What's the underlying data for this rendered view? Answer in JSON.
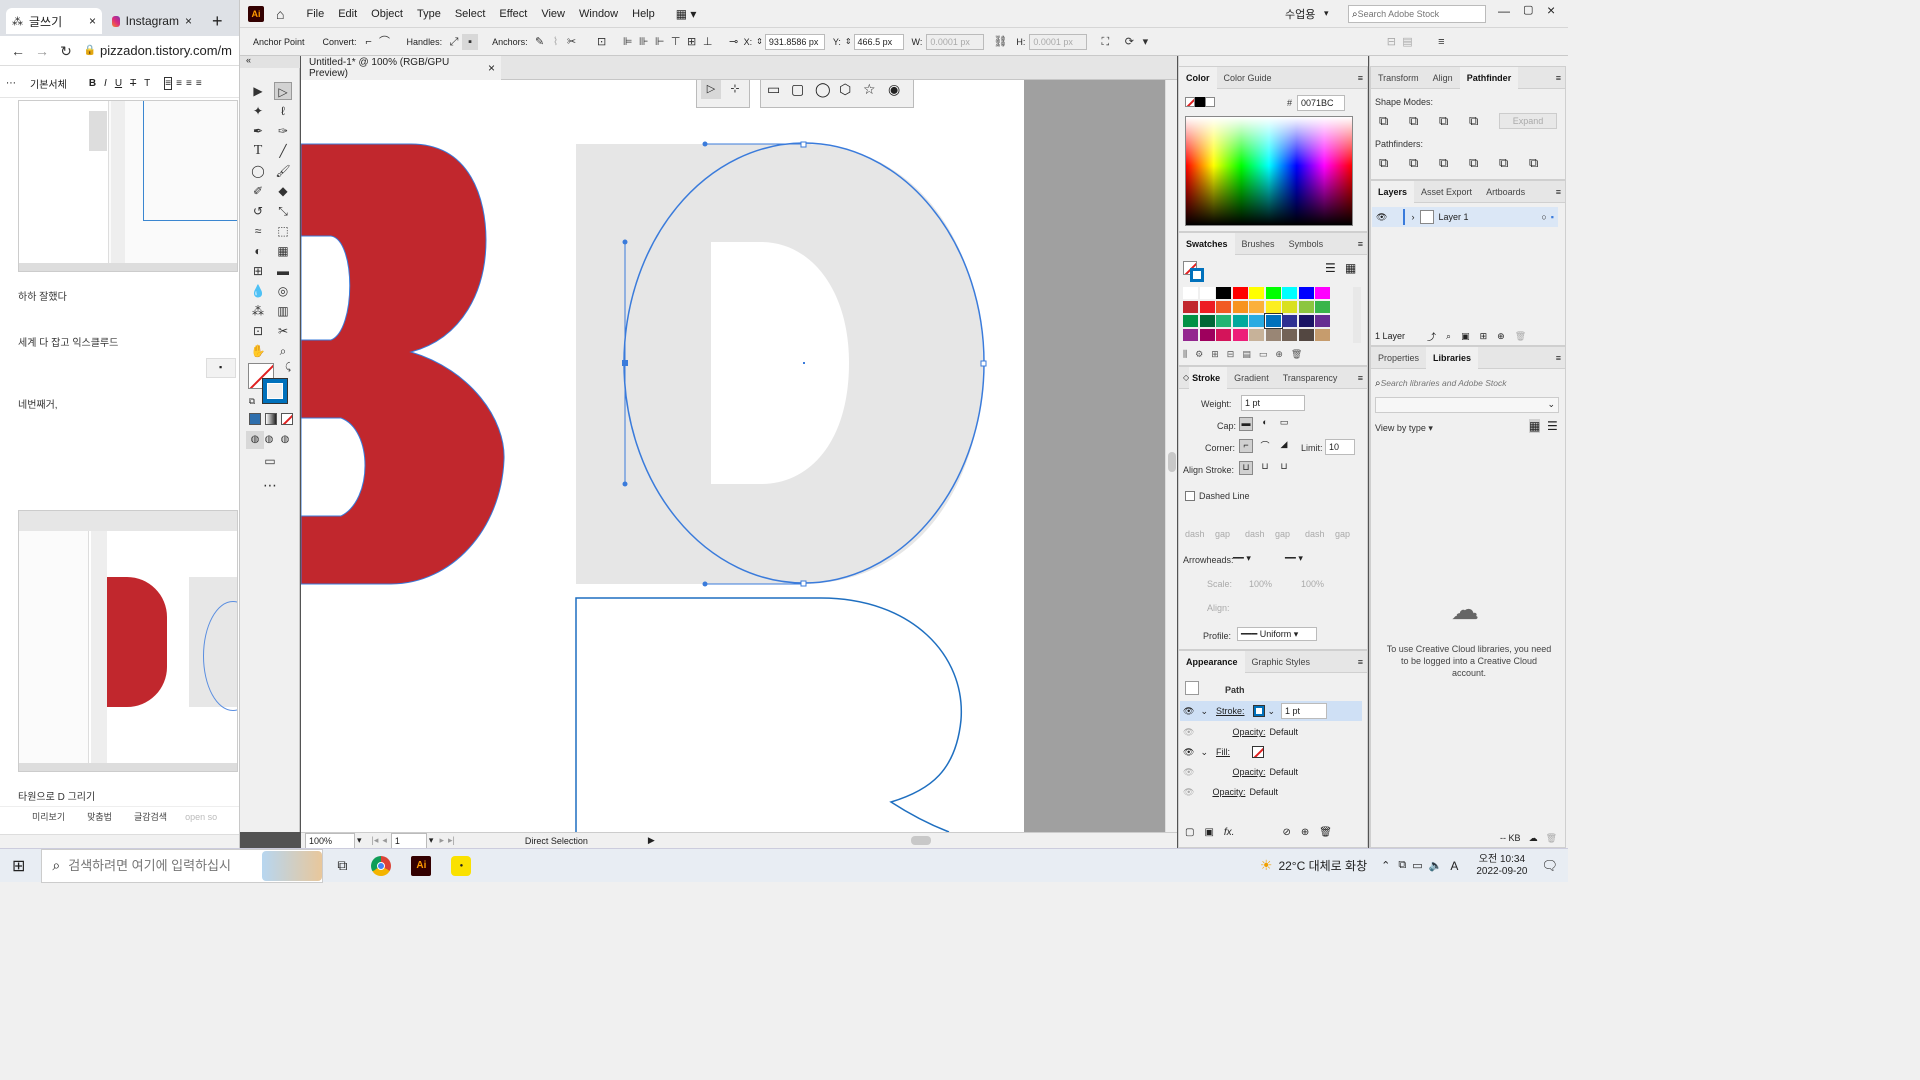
{
  "browser": {
    "tabs": [
      {
        "label": "글쓰기",
        "icon": "tistory-icon"
      },
      {
        "label": "Instagram",
        "icon": "instagram-icon"
      }
    ],
    "new_tab": "+",
    "url": "pizzadon.tistory.com/m",
    "editor": {
      "font_label": "기본서체",
      "bold": "B",
      "italic": "I",
      "underline": "U",
      "strike": "T",
      "text_color": "T"
    },
    "texts": [
      "하하 잘했다",
      "세계 다 잡고 익스클루드",
      "네번째거,",
      "타원으로 D 그리기"
    ],
    "bottom": {
      "preview": "미리보기",
      "spell": "맞춤법",
      "draft": "글감검색",
      "open": "open so"
    }
  },
  "ai": {
    "logo": "Ai",
    "menus": [
      "File",
      "Edit",
      "Object",
      "Type",
      "Select",
      "Effect",
      "View",
      "Window",
      "Help"
    ],
    "workspace": "수업용",
    "search_placeholder": "Search Adobe Stock",
    "control": {
      "anchor_point": "Anchor Point",
      "convert": "Convert:",
      "handles": "Handles:",
      "anchors": "Anchors:",
      "x_label": "X:",
      "x_value": "931.8586 px",
      "y_label": "Y:",
      "y_value": "466.5 px",
      "w_label": "W:",
      "w_value": "0.0001 px",
      "h_label": "H:",
      "h_value": "0.0001 px"
    },
    "doc_tab": "Untitled-1* @ 100% (RGB/GPU Preview)",
    "doc_close": "×",
    "status": {
      "zoom": "100%",
      "artboard": "1",
      "tool": "Direct Selection"
    },
    "color_panel": {
      "tabs": [
        "Color",
        "Color Guide"
      ],
      "hex_label": "#",
      "hex": "0071BC"
    },
    "swatches_panel": {
      "tabs": [
        "Swatches",
        "Brushes",
        "Symbols"
      ]
    },
    "stroke_panel": {
      "tabs": [
        "Stroke",
        "Gradient",
        "Transparency"
      ],
      "weight_label": "Weight:",
      "weight": "1 pt",
      "cap_label": "Cap:",
      "corner_label": "Corner:",
      "limit_label": "Limit:",
      "limit": "10",
      "align_label": "Align Stroke:",
      "dashed": "Dashed Line",
      "dash": "dash",
      "gap": "gap",
      "arrowheads": "Arrowheads:",
      "scale": "Scale:",
      "scale1": "100%",
      "scale2": "100%",
      "align": "Align:",
      "profile": "Profile:",
      "profile_value": "Uniform"
    },
    "appearance_panel": {
      "tabs": [
        "Appearance",
        "Graphic Styles"
      ],
      "path": "Path",
      "stroke": "Stroke:",
      "stroke_weight": "1 pt",
      "opacity": "Opacity:",
      "default": "Default",
      "fill": "Fill:"
    },
    "pathfinder_panel": {
      "tabs": [
        "Transform",
        "Align",
        "Pathfinder"
      ],
      "shape_modes": "Shape Modes:",
      "expand": "Expand",
      "pathfinders": "Pathfinders:"
    },
    "layers_panel": {
      "tabs": [
        "Layers",
        "Asset Export",
        "Artboards"
      ],
      "layer_name": "Layer 1",
      "count": "1 Layer"
    },
    "libraries_panel": {
      "tabs": [
        "Properties",
        "Libraries"
      ],
      "search_placeholder": "Search libraries and Adobe Stock",
      "view_by": "View by type",
      "message": "To use Creative Cloud libraries, you need to be logged into a Creative Cloud account.",
      "kb": "-- KB"
    }
  },
  "taskbar": {
    "search_placeholder": "검색하려면 여기에 입력하십시",
    "weather": "22°C 대체로 화창",
    "ime": "A",
    "time": "오전 10:34",
    "date": "2022-09-20"
  },
  "colors": {
    "accent": "#0071BC",
    "letter_b": "#c1272d",
    "ellipse_stroke": "#3a7bdb"
  }
}
